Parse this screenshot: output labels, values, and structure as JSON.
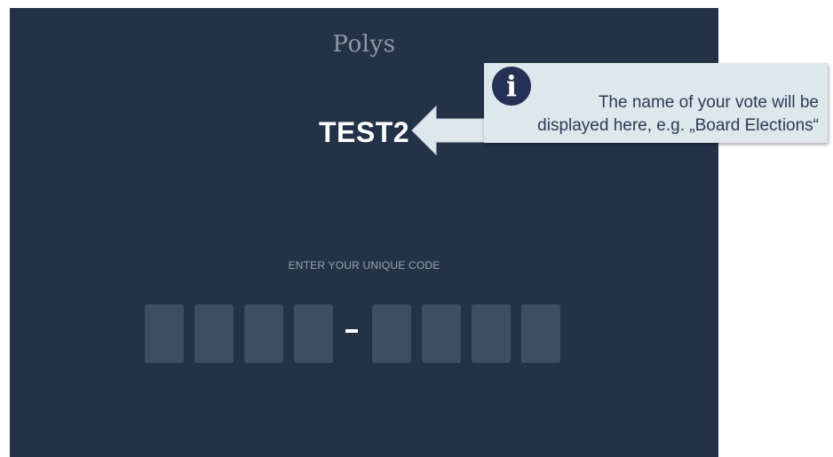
{
  "app": {
    "logo": "Polys",
    "vote_title": "TEST2",
    "code_label": "ENTER YOUR UNIQUE CODE",
    "code_separator": "-",
    "code_fields": [
      "",
      "",
      "",
      "",
      "",
      "",
      "",
      ""
    ]
  },
  "callout": {
    "icon": "info-icon",
    "line1": "The name of your vote will be",
    "line2": "displayed here, e.g. „Board Elections“"
  },
  "colors": {
    "background": "#233247",
    "code_box": "#3c4d64",
    "callout_bg": "#dde7ec",
    "callout_icon": "#243054"
  }
}
